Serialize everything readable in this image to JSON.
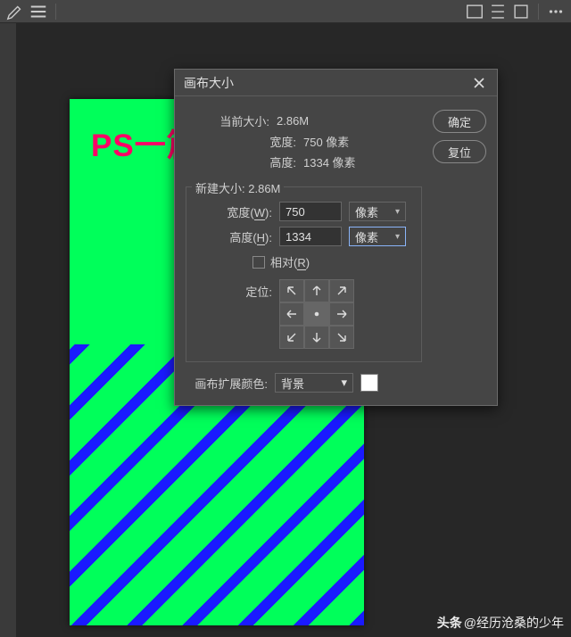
{
  "dialog": {
    "title": "画布大小",
    "ok_label": "确定",
    "reset_label": "复位",
    "current_size": {
      "legend": "当前大小:",
      "size_value": "2.86M",
      "width_label": "宽度:",
      "width_value": "750 像素",
      "height_label": "高度:",
      "height_value": "1334 像素"
    },
    "new_size": {
      "legend": "新建大小:",
      "size_value": "2.86M",
      "width_label": "宽度(W):",
      "width_value": "750",
      "width_unit": "像素",
      "height_label": "高度(H):",
      "height_value": "1334",
      "height_unit": "像素",
      "relative_label": "相对(R)",
      "anchor_label": "定位:"
    },
    "extension": {
      "label": "画布扩展颜色:",
      "value": "背景",
      "swatch": "#ffffff"
    }
  },
  "canvas": {
    "text": "PS一篇"
  },
  "watermark": {
    "brand": "头条",
    "user": "@经历沧桑的少年"
  }
}
